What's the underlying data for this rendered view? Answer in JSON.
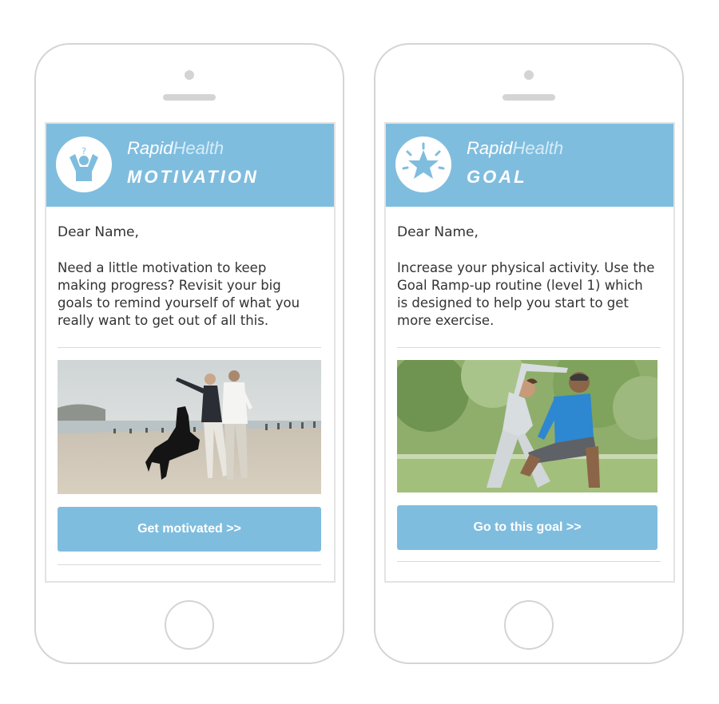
{
  "cards": [
    {
      "brand_part1": "Rapid",
      "brand_part2": "Health",
      "category": "MOTIVATION",
      "icon": "person-cheering-icon",
      "greeting": "Dear Name,",
      "body": "Need a little motivation to keep making progress? Revisit your big goals to remind yourself of what you really want to get out of all this.",
      "image": "couple-with-dog-on-beach-photo",
      "button_label": "Get motivated >>"
    },
    {
      "brand_part1": "Rapid",
      "brand_part2": "Health",
      "category": "GOAL",
      "icon": "star-burst-icon",
      "greeting": "Dear Name,",
      "body": "Increase your physical activity. Use the Goal Ramp-up routine (level 1) which is designed to help you start to get more exercise.",
      "image": "couple-stretching-in-park-photo",
      "button_label": "Go to this goal >>"
    }
  ],
  "colors": {
    "accent": "#7fbddf",
    "frame": "#d4d4d4",
    "text": "#333333"
  }
}
